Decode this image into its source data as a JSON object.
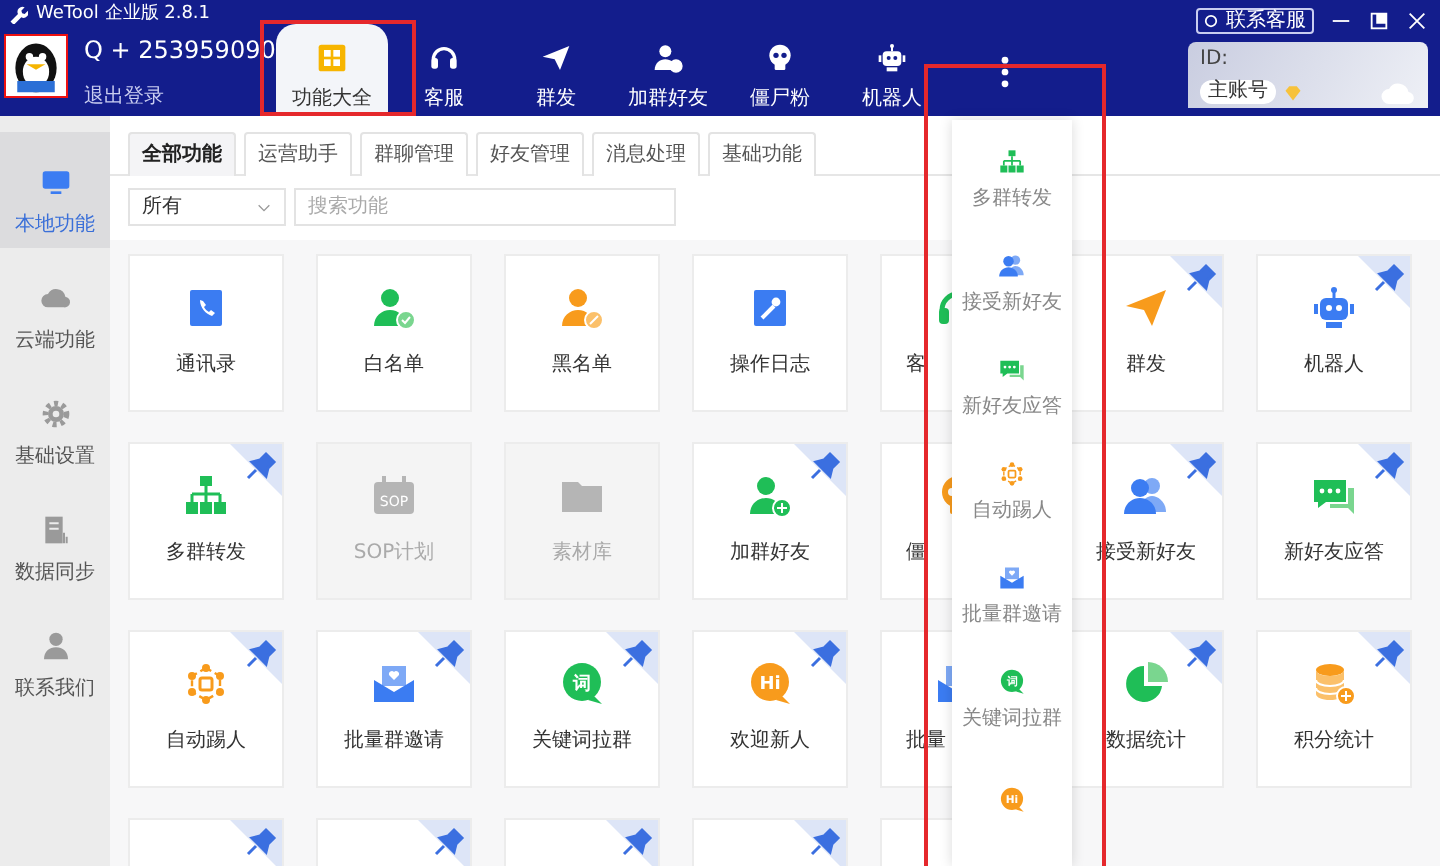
{
  "app": {
    "title": "WeTool 企业版 2.8.1",
    "account": "Q + 253959090",
    "logout": "退出登录",
    "support": "联系客服"
  },
  "nav": [
    {
      "label": "功能大全",
      "kind": "grid",
      "selected": true
    },
    {
      "label": "客服",
      "kind": "headset",
      "selected": false
    },
    {
      "label": "群发",
      "kind": "plane",
      "selected": false
    },
    {
      "label": "加群好友",
      "kind": "person-add",
      "selected": false
    },
    {
      "label": "僵尸粉",
      "kind": "skull",
      "selected": false
    },
    {
      "label": "机器人",
      "kind": "robot",
      "selected": false
    },
    {
      "kind": "more",
      "selected": false
    }
  ],
  "id_card": {
    "label": "ID:",
    "role": "主账号"
  },
  "sidebar": [
    {
      "label": "本地功能",
      "kind": "monitor",
      "selected": true
    },
    {
      "label": "云端功能",
      "kind": "cloud",
      "selected": false
    },
    {
      "label": "基础设置",
      "kind": "gear",
      "selected": false
    },
    {
      "label": "数据同步",
      "kind": "doc",
      "selected": false
    },
    {
      "label": "联系我们",
      "kind": "user",
      "selected": false
    }
  ],
  "tabs": [
    {
      "label": "全部功能",
      "selected": true
    },
    {
      "label": "运营助手",
      "selected": false
    },
    {
      "label": "群聊管理",
      "selected": false
    },
    {
      "label": "好友管理",
      "selected": false
    },
    {
      "label": "消息处理",
      "selected": false
    },
    {
      "label": "基础功能",
      "selected": false
    }
  ],
  "filter": {
    "value": "所有",
    "placeholder": "搜索功能"
  },
  "cards": [
    {
      "label": "通讯录",
      "kind": "contacts",
      "pinned": false
    },
    {
      "label": "白名单",
      "kind": "person-check",
      "pinned": false
    },
    {
      "label": "黑名单",
      "kind": "person-edit",
      "pinned": false
    },
    {
      "label": "操作日志",
      "kind": "log",
      "pinned": false
    },
    {
      "label": "客",
      "kind": "headset",
      "pinned": false,
      "covered": true
    },
    {
      "label": "群发",
      "kind": "plane",
      "pinned": true
    },
    {
      "label": "机器人",
      "kind": "robot",
      "pinned": true
    },
    {
      "label": "多群转发",
      "kind": "org",
      "pinned": true
    },
    {
      "label": "SOP计划",
      "kind": "calendar",
      "icon_text": "SOP",
      "pinned": false,
      "disabled": true
    },
    {
      "label": "素材库",
      "kind": "folder",
      "pinned": false,
      "disabled": true
    },
    {
      "label": "加群好友",
      "kind": "person-add",
      "pinned": true
    },
    {
      "label": "僵",
      "kind": "skull",
      "pinned": false,
      "covered": true
    },
    {
      "label": "接受新好友",
      "kind": "people",
      "pinned": true
    },
    {
      "label": "新好友应答",
      "kind": "chat",
      "pinned": true
    },
    {
      "label": "自动踢人",
      "kind": "kick",
      "pinned": true
    },
    {
      "label": "批量群邀请",
      "kind": "mail",
      "pinned": true
    },
    {
      "label": "关键词拉群",
      "kind": "bubble-green",
      "icon_text": "词",
      "pinned": true
    },
    {
      "label": "欢迎新人",
      "kind": "bubble-orange",
      "icon_text": "Hi",
      "pinned": true
    },
    {
      "label": "批量",
      "kind": "mail",
      "pinned": false,
      "covered": true
    },
    {
      "label": "数据统计",
      "kind": "pie",
      "pinned": true
    },
    {
      "label": "积分统计",
      "kind": "coins",
      "pinned": true
    },
    {
      "kind": "cut",
      "pinned": true
    },
    {
      "kind": "cut",
      "pinned": true
    },
    {
      "kind": "cut",
      "pinned": true
    },
    {
      "kind": "cut",
      "pinned": true
    },
    {
      "kind": "cut",
      "pinned": false
    }
  ],
  "more_menu": [
    {
      "label": "多群转发",
      "kind": "org"
    },
    {
      "label": "接受新好友",
      "kind": "people"
    },
    {
      "label": "新好友应答",
      "kind": "chat"
    },
    {
      "label": "自动踢人",
      "kind": "kick"
    },
    {
      "label": "批量群邀请",
      "kind": "mail"
    },
    {
      "label": "关键词拉群",
      "kind": "bubble-green",
      "icon_text": "词"
    },
    {
      "kind": "bubble-orange",
      "icon_text": "Hi"
    }
  ]
}
